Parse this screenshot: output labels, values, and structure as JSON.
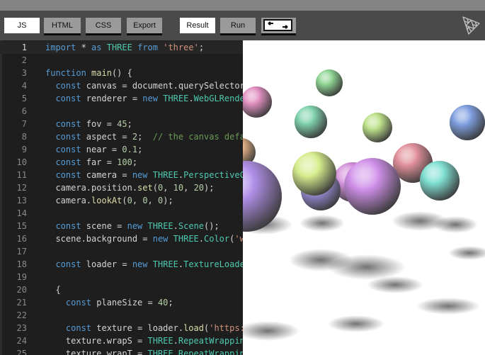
{
  "toolbar": {
    "js": "JS",
    "html": "HTML",
    "css": "CSS",
    "export": "Export",
    "result": "Result",
    "run": "Run"
  },
  "icons": {
    "toggle": "split-view-toggle-icon",
    "logo": "threejs-logo"
  },
  "colors": {
    "toolbar": "#4a4a4a",
    "editor_bg": "#1e1e1e",
    "keyword": "#569cd6",
    "class": "#4ec9b0",
    "string": "#ce9178",
    "number": "#b5cea8",
    "comment": "#6a9955"
  },
  "editor": {
    "active_line": 1,
    "lines": [
      {
        "n": "1",
        "tokens": [
          [
            "k",
            "import"
          ],
          [
            "p",
            " * "
          ],
          [
            "k",
            "as"
          ],
          [
            "p",
            " "
          ],
          [
            "c",
            "THREE"
          ],
          [
            "p",
            " "
          ],
          [
            "k",
            "from"
          ],
          [
            "p",
            " "
          ],
          [
            "s",
            "'three'"
          ],
          [
            "p",
            ";"
          ]
        ]
      },
      {
        "n": "2",
        "tokens": []
      },
      {
        "n": "3",
        "tokens": [
          [
            "k",
            "function"
          ],
          [
            "p",
            " "
          ],
          [
            "f",
            "main"
          ],
          [
            "p",
            "() {"
          ]
        ]
      },
      {
        "n": "4",
        "tokens": [
          [
            "p",
            "  "
          ],
          [
            "k",
            "const"
          ],
          [
            "p",
            " canvas = document.querySelector"
          ]
        ]
      },
      {
        "n": "5",
        "tokens": [
          [
            "p",
            "  "
          ],
          [
            "k",
            "const"
          ],
          [
            "p",
            " renderer = "
          ],
          [
            "k",
            "new"
          ],
          [
            "p",
            " "
          ],
          [
            "c",
            "THREE"
          ],
          [
            "p",
            "."
          ],
          [
            "c",
            "WebGLRende"
          ]
        ]
      },
      {
        "n": "6",
        "tokens": []
      },
      {
        "n": "7",
        "tokens": [
          [
            "p",
            "  "
          ],
          [
            "k",
            "const"
          ],
          [
            "p",
            " fov = "
          ],
          [
            "n",
            "45"
          ],
          [
            "p",
            ";"
          ]
        ]
      },
      {
        "n": "8",
        "tokens": [
          [
            "p",
            "  "
          ],
          [
            "k",
            "const"
          ],
          [
            "p",
            " aspect = "
          ],
          [
            "n",
            "2"
          ],
          [
            "p",
            ";  "
          ],
          [
            "cm",
            "// the canvas defa"
          ]
        ]
      },
      {
        "n": "9",
        "tokens": [
          [
            "p",
            "  "
          ],
          [
            "k",
            "const"
          ],
          [
            "p",
            " near = "
          ],
          [
            "n",
            "0.1"
          ],
          [
            "p",
            ";"
          ]
        ]
      },
      {
        "n": "10",
        "tokens": [
          [
            "p",
            "  "
          ],
          [
            "k",
            "const"
          ],
          [
            "p",
            " far = "
          ],
          [
            "n",
            "100"
          ],
          [
            "p",
            ";"
          ]
        ]
      },
      {
        "n": "11",
        "tokens": [
          [
            "p",
            "  "
          ],
          [
            "k",
            "const"
          ],
          [
            "p",
            " camera = "
          ],
          [
            "k",
            "new"
          ],
          [
            "p",
            " "
          ],
          [
            "c",
            "THREE"
          ],
          [
            "p",
            "."
          ],
          [
            "c",
            "PerspectiveC"
          ]
        ]
      },
      {
        "n": "12",
        "tokens": [
          [
            "p",
            "  camera.position."
          ],
          [
            "f",
            "set"
          ],
          [
            "p",
            "("
          ],
          [
            "n",
            "0"
          ],
          [
            "p",
            ", "
          ],
          [
            "n",
            "10"
          ],
          [
            "p",
            ", "
          ],
          [
            "n",
            "20"
          ],
          [
            "p",
            ");"
          ]
        ]
      },
      {
        "n": "13",
        "tokens": [
          [
            "p",
            "  camera."
          ],
          [
            "f",
            "lookAt"
          ],
          [
            "p",
            "("
          ],
          [
            "n",
            "0"
          ],
          [
            "p",
            ", "
          ],
          [
            "n",
            "0"
          ],
          [
            "p",
            ", "
          ],
          [
            "n",
            "0"
          ],
          [
            "p",
            ");"
          ]
        ]
      },
      {
        "n": "14",
        "tokens": []
      },
      {
        "n": "15",
        "tokens": [
          [
            "p",
            "  "
          ],
          [
            "k",
            "const"
          ],
          [
            "p",
            " scene = "
          ],
          [
            "k",
            "new"
          ],
          [
            "p",
            " "
          ],
          [
            "c",
            "THREE"
          ],
          [
            "p",
            "."
          ],
          [
            "c",
            "Scene"
          ],
          [
            "p",
            "();"
          ]
        ]
      },
      {
        "n": "16",
        "tokens": [
          [
            "p",
            "  scene.background = "
          ],
          [
            "k",
            "new"
          ],
          [
            "p",
            " "
          ],
          [
            "c",
            "THREE"
          ],
          [
            "p",
            "."
          ],
          [
            "c",
            "Color"
          ],
          [
            "p",
            "("
          ],
          [
            "s",
            "'w"
          ]
        ]
      },
      {
        "n": "17",
        "tokens": []
      },
      {
        "n": "18",
        "tokens": [
          [
            "p",
            "  "
          ],
          [
            "k",
            "const"
          ],
          [
            "p",
            " loader = "
          ],
          [
            "k",
            "new"
          ],
          [
            "p",
            " "
          ],
          [
            "c",
            "THREE"
          ],
          [
            "p",
            "."
          ],
          [
            "c",
            "TextureLoade"
          ]
        ]
      },
      {
        "n": "19",
        "tokens": []
      },
      {
        "n": "20",
        "tokens": [
          [
            "p",
            "  {"
          ]
        ]
      },
      {
        "n": "21",
        "tokens": [
          [
            "p",
            "    "
          ],
          [
            "k",
            "const"
          ],
          [
            "p",
            " planeSize = "
          ],
          [
            "n",
            "40"
          ],
          [
            "p",
            ";"
          ]
        ]
      },
      {
        "n": "22",
        "tokens": []
      },
      {
        "n": "23",
        "tokens": [
          [
            "p",
            "    "
          ],
          [
            "k",
            "const"
          ],
          [
            "p",
            " texture = loader."
          ],
          [
            "f",
            "load"
          ],
          [
            "p",
            "("
          ],
          [
            "s",
            "'https:"
          ]
        ]
      },
      {
        "n": "24",
        "tokens": [
          [
            "p",
            "    texture.wrapS = "
          ],
          [
            "c",
            "THREE"
          ],
          [
            "p",
            "."
          ],
          [
            "c",
            "RepeatWrappin"
          ]
        ]
      },
      {
        "n": "25",
        "tokens": [
          [
            "p",
            "    texture.wrapT = "
          ],
          [
            "c",
            "THREE"
          ],
          [
            "p",
            "."
          ],
          [
            "c",
            "RepeatWrappin"
          ]
        ]
      }
    ]
  },
  "scene": {
    "spheres": [
      {
        "name": "sphere-green-top",
        "color": "#8fd492"
      },
      {
        "name": "sphere-pink-left",
        "color": "#e08fbf"
      },
      {
        "name": "sphere-teal-left",
        "color": "#7fd2ad"
      },
      {
        "name": "sphere-lime-center",
        "color": "#bde08a"
      },
      {
        "name": "sphere-blue-right",
        "color": "#7f9fe0"
      },
      {
        "name": "sphere-tan-edge",
        "color": "#d9a87f"
      },
      {
        "name": "sphere-red",
        "color": "#e08f9a"
      },
      {
        "name": "sphere-cyan",
        "color": "#7fe0d2"
      },
      {
        "name": "sphere-violet-back",
        "color": "#d28fd9"
      },
      {
        "name": "sphere-indigo",
        "color": "#9d8fe0"
      },
      {
        "name": "sphere-yellow-green",
        "color": "#d6ec8c"
      },
      {
        "name": "sphere-magenta-big",
        "color": "#cf8fe8"
      },
      {
        "name": "sphere-lavender-big",
        "color": "#b08fe8"
      }
    ]
  }
}
